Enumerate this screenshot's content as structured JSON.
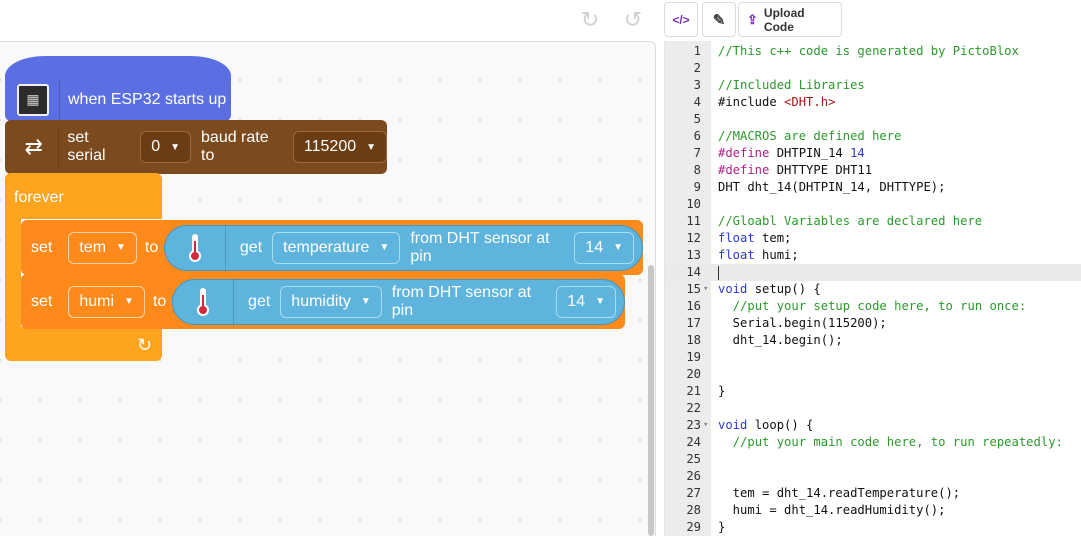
{
  "toolbar": {
    "redo_icon": "redo-icon",
    "undo_icon": "undo-icon",
    "code_icon": "code-icon",
    "tools_icon": "wrench-icon",
    "upload_label": "Upload Code"
  },
  "blocks": {
    "hat_label": "when ESP32 starts up",
    "serial": {
      "label1": "set serial",
      "port": "0",
      "label2": "baud rate to",
      "baud": "115200"
    },
    "forever_label": "forever",
    "set1": {
      "set": "set",
      "var": "tem",
      "to": "to",
      "get": "get",
      "reading": "temperature",
      "from": "from DHT sensor at pin",
      "pin": "14"
    },
    "set2": {
      "set": "set",
      "var": "humi",
      "to": "to",
      "get": "get",
      "reading": "humidity",
      "from": "from DHT sensor at pin",
      "pin": "14"
    }
  },
  "code_lines": [
    {
      "n": "1",
      "t": "//This c++ code is generated by PictoBlox"
    },
    {
      "n": "2",
      "t": ""
    },
    {
      "n": "3",
      "t": "//Included Libraries"
    },
    {
      "n": "4",
      "t": "#include <DHT.h>"
    },
    {
      "n": "5",
      "t": ""
    },
    {
      "n": "6",
      "t": "//MACROS are defined here"
    },
    {
      "n": "7",
      "t": "#define DHTPIN_14 14"
    },
    {
      "n": "8",
      "t": "#define DHTTYPE DHT11"
    },
    {
      "n": "9",
      "t": "DHT dht_14(DHTPIN_14, DHTTYPE);"
    },
    {
      "n": "10",
      "t": ""
    },
    {
      "n": "11",
      "t": "//Gloabl Variables are declared here"
    },
    {
      "n": "12",
      "t": "float tem;"
    },
    {
      "n": "13",
      "t": "float humi;"
    },
    {
      "n": "14",
      "t": ""
    },
    {
      "n": "15",
      "t": "void setup() {"
    },
    {
      "n": "16",
      "t": "  //put your setup code here, to run once:"
    },
    {
      "n": "17",
      "t": "  Serial.begin(115200);"
    },
    {
      "n": "18",
      "t": "  dht_14.begin();"
    },
    {
      "n": "19",
      "t": ""
    },
    {
      "n": "20",
      "t": ""
    },
    {
      "n": "21",
      "t": "}"
    },
    {
      "n": "22",
      "t": ""
    },
    {
      "n": "23",
      "t": "void loop() {"
    },
    {
      "n": "24",
      "t": "  //put your main code here, to run repeatedly:"
    },
    {
      "n": "25",
      "t": ""
    },
    {
      "n": "26",
      "t": ""
    },
    {
      "n": "27",
      "t": "  tem = dht_14.readTemperature();"
    },
    {
      "n": "28",
      "t": "  humi = dht_14.readHumidity();"
    },
    {
      "n": "29",
      "t": "}"
    }
  ]
}
